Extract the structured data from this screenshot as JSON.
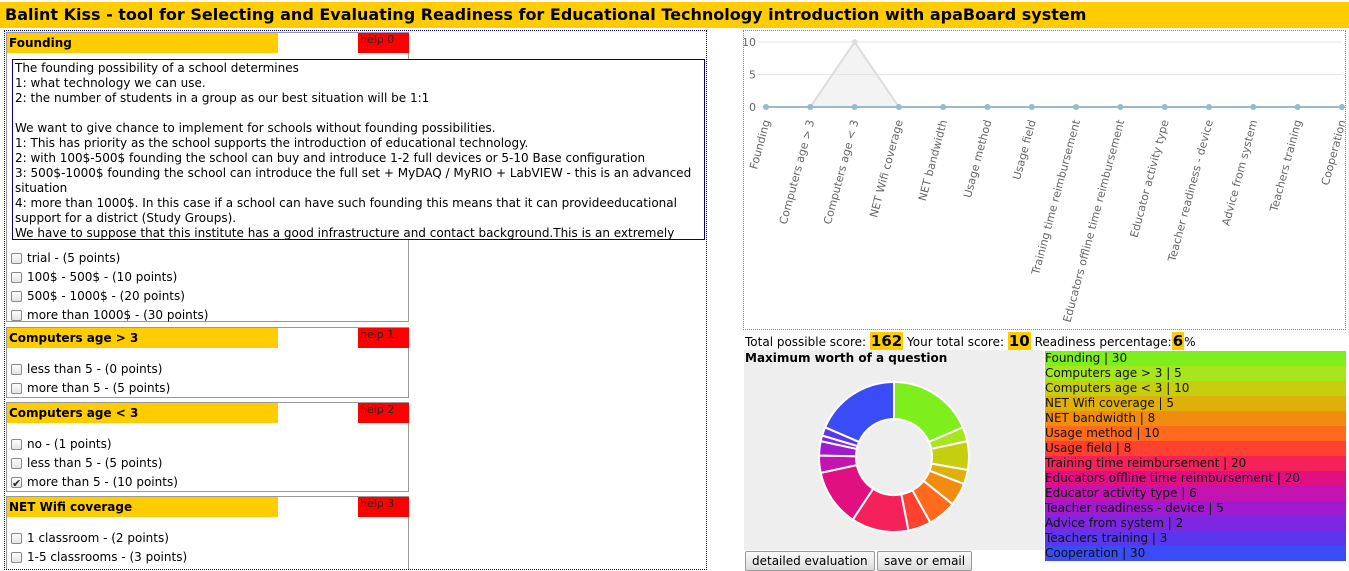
{
  "title": "Balint Kiss - tool for Selecting and Evaluating Readiness for Educational Technology introduction with apaBoard system",
  "help_popup": [
    "The founding possibility of a school determines",
    "1: what technology we can use.",
    "2: the number of students in a group as our best situation will be 1:1",
    "",
    "We want to give chance to implement for schools without founding possibilities.",
    "1: This has priority as the school supports the introduction of educational technology.",
    "2: with 100$-500$ founding the school can buy and introduce 1-2 full devices or 5-10 Base configuration",
    "3: 500$-1000$ founding the school can introduce the full set + MyDAQ / MyRIO + LabVIEW - this is an advanced situation",
    "4: more than 1000$. In this case if a school can have such founding this means that it can provideeducational support for a district (Study Groups).",
    "We have to suppose that this institute has a good infrastructure and contact background.This is an extremely good situation."
  ],
  "questions": [
    {
      "title": "Founding",
      "help": "help 0",
      "options": [
        {
          "label": "trial - (5 points)",
          "checked": false
        },
        {
          "label": "100$ - 500$ - (10 points)",
          "checked": false
        },
        {
          "label": "500$ - 1000$ - (20 points)",
          "checked": false
        },
        {
          "label": "more than 1000$ - (30 points)",
          "checked": false
        }
      ]
    },
    {
      "title": "Computers age > 3",
      "help": "help 1",
      "options": [
        {
          "label": "less than 5 - (0 points)",
          "checked": false
        },
        {
          "label": "more than 5 - (5 points)",
          "checked": false
        }
      ]
    },
    {
      "title": "Computers age < 3",
      "help": "help 2",
      "options": [
        {
          "label": "no - (1 points)",
          "checked": false
        },
        {
          "label": "less than 5 - (5 points)",
          "checked": false
        },
        {
          "label": "more than 5 - (10 points)",
          "checked": true
        }
      ]
    },
    {
      "title": "NET Wifi coverage",
      "help": "help 3",
      "options": [
        {
          "label": "1 classroom - (2 points)",
          "checked": false
        },
        {
          "label": "1-5 classrooms - (3 points)",
          "checked": false
        }
      ]
    }
  ],
  "chart_data": [
    {
      "type": "line",
      "categories": [
        "Founding",
        "Computers age > 3",
        "Computers age < 3",
        "NET Wifi coverage",
        "NET bandwidth",
        "Usage method",
        "Usage field",
        "Training time reimbursement",
        "Educators offline time reimbursement",
        "Educator activity type",
        "Teacher readiness - device",
        "Advice from system",
        "Teachers training",
        "Cooperation"
      ],
      "series": [
        {
          "values": [
            0,
            0,
            10,
            0,
            0,
            0,
            0,
            0,
            0,
            0,
            0,
            0,
            0,
            0
          ],
          "color": "#dddddd"
        },
        {
          "values": [
            0,
            0,
            0,
            0,
            0,
            0,
            0,
            0,
            0,
            0,
            0,
            0,
            0,
            0
          ],
          "color": "#97bbcd"
        }
      ],
      "y_ticks": [
        "0",
        "5",
        "10"
      ],
      "ylim": [
        0,
        10
      ]
    },
    {
      "type": "pie",
      "title": "Maximum worth of a question",
      "labels": [
        "Founding",
        "Computers age > 3",
        "Computers age < 3",
        "NET Wifi coverage",
        "NET bandwidth",
        "Usage method",
        "Usage field",
        "Training time reimbursement",
        "Educators offline time reimbursement",
        "Educator activity type",
        "Teacher readiness - device",
        "Advice from system",
        "Teachers training",
        "Cooperation"
      ],
      "values": [
        30,
        5,
        10,
        5,
        8,
        10,
        8,
        20,
        20,
        6,
        5,
        2,
        3,
        30
      ],
      "colors": [
        "#7fee1d",
        "#a6e61d",
        "#c5cf10",
        "#dfb00a",
        "#f28c10",
        "#ff6a1c",
        "#ff4130",
        "#f5215a",
        "#e01080",
        "#c413b0",
        "#a01ad0",
        "#7d27e3",
        "#5a37ee",
        "#3a4cf5"
      ],
      "legend": [
        "Founding | 30",
        "Computers age > 3 | 5",
        "Computers age < 3 | 10",
        "NET Wifi coverage | 5",
        "NET bandwidth | 8",
        "Usage method | 10",
        "Usage field | 8",
        "Training time reimbursement | 20",
        "Educators offline time reimbursement | 20",
        "Educator activity type | 6",
        "Teacher readiness - device | 5",
        "Advice from system | 2",
        "Teachers training | 3",
        "Cooperation | 30"
      ]
    }
  ],
  "scores": {
    "possible_label": "Total possible score:",
    "possible": "162",
    "yours_label": "Your total score:",
    "yours": "10",
    "readiness_label": "Readiness percentage:",
    "readiness": "6",
    "percent": "%"
  },
  "buttons": {
    "detailed": "detailed evaluation",
    "save": "save or email"
  }
}
